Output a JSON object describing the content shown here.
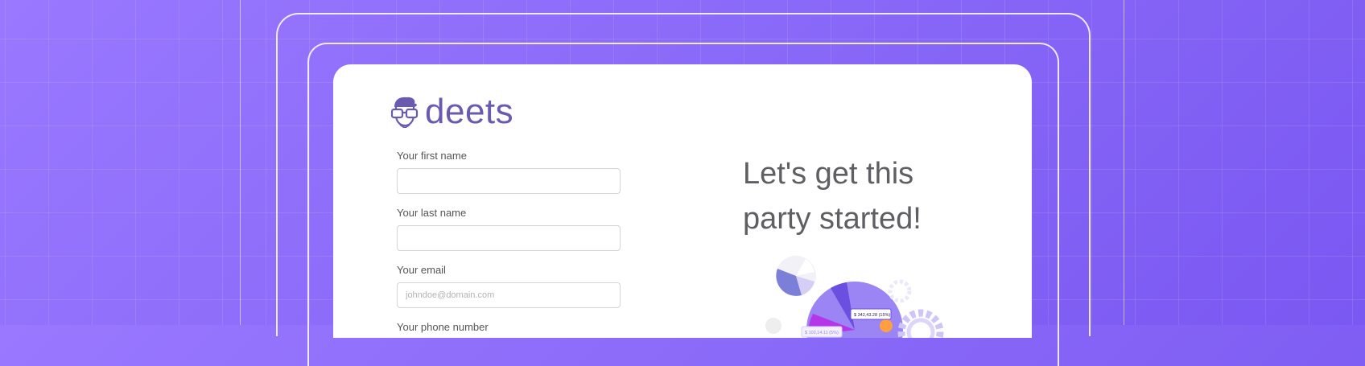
{
  "brand": {
    "name": "deets"
  },
  "form": {
    "first_name": {
      "label": "Your first name",
      "placeholder": ""
    },
    "last_name": {
      "label": "Your last name",
      "placeholder": ""
    },
    "email": {
      "label": "Your email",
      "placeholder": "johndoe@domain.com"
    },
    "phone": {
      "label": "Your phone number"
    }
  },
  "hero": {
    "line1": "Let's get this",
    "line2": "party started!"
  },
  "illustration": {
    "tag_primary": "$ 342,43.28 (15%)",
    "tag_secondary": "$ 102,14.11 (5%)"
  },
  "colors": {
    "background": "#8a6af8",
    "brand": "#6a5bb0",
    "accent": "#8b6cf6"
  }
}
